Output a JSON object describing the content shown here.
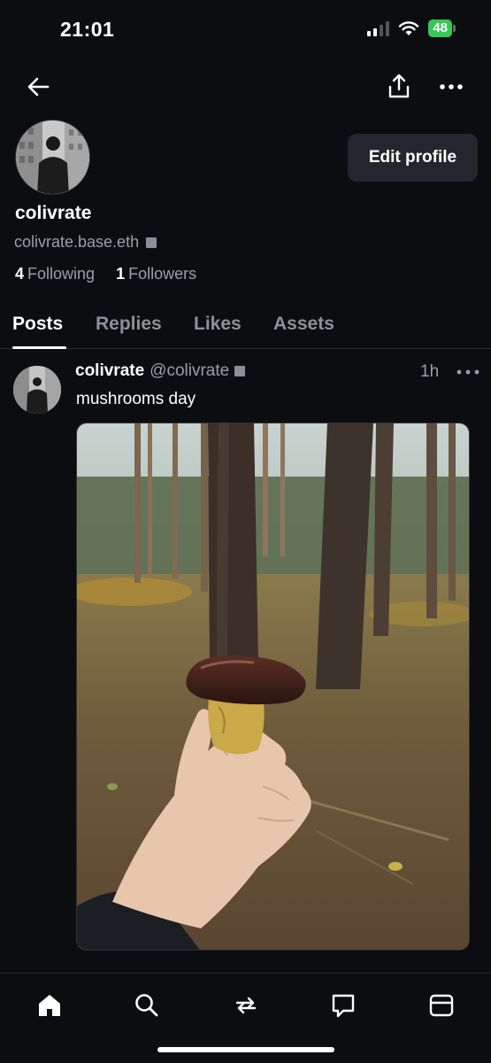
{
  "status_bar": {
    "time": "21:01",
    "battery": "48"
  },
  "profile": {
    "display_name": "colivrate",
    "handle": "colivrate.base.eth",
    "following_count": "4",
    "following_label": "Following",
    "followers_count": "1",
    "followers_label": "Followers",
    "edit_label": "Edit profile"
  },
  "tabs": [
    {
      "label": "Posts",
      "active": true
    },
    {
      "label": "Replies",
      "active": false
    },
    {
      "label": "Likes",
      "active": false
    },
    {
      "label": "Assets",
      "active": false
    }
  ],
  "post": {
    "author_name": "colivrate",
    "author_handle": "@colivrate",
    "time": "1h",
    "text": "mushrooms day"
  },
  "icons": {
    "back": "arrow-left-icon",
    "share": "share-icon",
    "more": "more-icon",
    "nav": [
      "home-icon",
      "search-icon",
      "repost-icon",
      "messages-icon",
      "wallet-icon"
    ]
  },
  "colors": {
    "background": "#0b0d10",
    "battery": "#37c75a",
    "button": "#23272d"
  }
}
